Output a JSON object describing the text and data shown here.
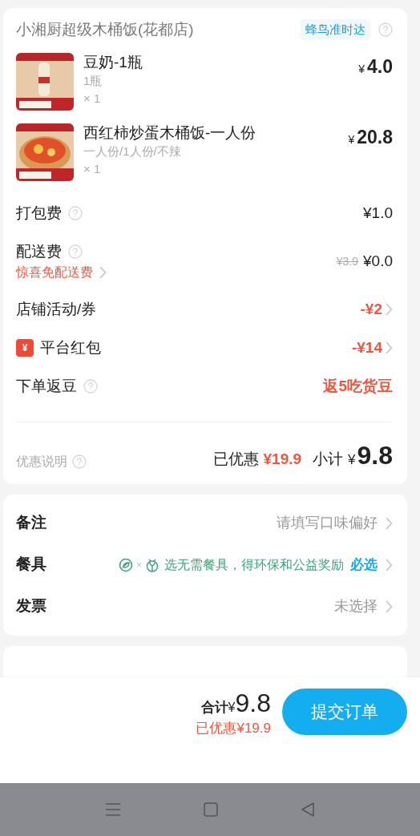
{
  "store": {
    "name": "小湘厨超级木桶饭(花都店)",
    "badge": "蜂鸟准时达"
  },
  "items": [
    {
      "name": "豆奶-1瓶",
      "spec": "1瓶",
      "quantity": "× 1",
      "currency": "¥",
      "price": "4.0",
      "kind": "bottle"
    },
    {
      "name": "西红柿炒蛋木桶饭-一人份",
      "spec": "一人份/1人份/不辣",
      "quantity": "× 1",
      "currency": "¥",
      "price": "20.8",
      "kind": "bowl"
    }
  ],
  "fees": [
    {
      "label": "打包费",
      "help": true,
      "value": "¥1.0",
      "highlight": false,
      "chevron": false
    },
    {
      "label": "配送费",
      "help": true,
      "link": "惊喜免配送费",
      "original_value": "¥3.9",
      "value": "¥0.0",
      "highlight": false,
      "chevron": false
    },
    {
      "label": "店铺活动/券",
      "help": false,
      "value": "-¥2",
      "highlight": true,
      "chevron": true
    },
    {
      "label": "平台红包",
      "badge": "¥",
      "help": false,
      "value": "-¥14",
      "highlight": true,
      "chevron": true
    },
    {
      "label": "下单返豆",
      "help": true,
      "value": "返5吃货豆",
      "highlight": true,
      "chevron": false
    }
  ],
  "summary": {
    "note": "优惠说明",
    "discount_label": "已优惠",
    "discount": "¥19.9",
    "subtotal_label": "小计",
    "currency": "¥",
    "subtotal": "9.8"
  },
  "options": [
    {
      "label": "备注",
      "kind": "text",
      "value": "请填写口味偏好"
    },
    {
      "label": "餐具",
      "kind": "eco",
      "separator": "×",
      "value": "选无需餐具，得环保和公益奖励",
      "tag": "必选"
    },
    {
      "label": "发票",
      "kind": "text",
      "value": "未选择"
    }
  ],
  "footer": {
    "total_label": "合计",
    "currency": "¥",
    "total": "9.8",
    "discount": "已优惠¥19.9",
    "submit": "提交订单"
  }
}
